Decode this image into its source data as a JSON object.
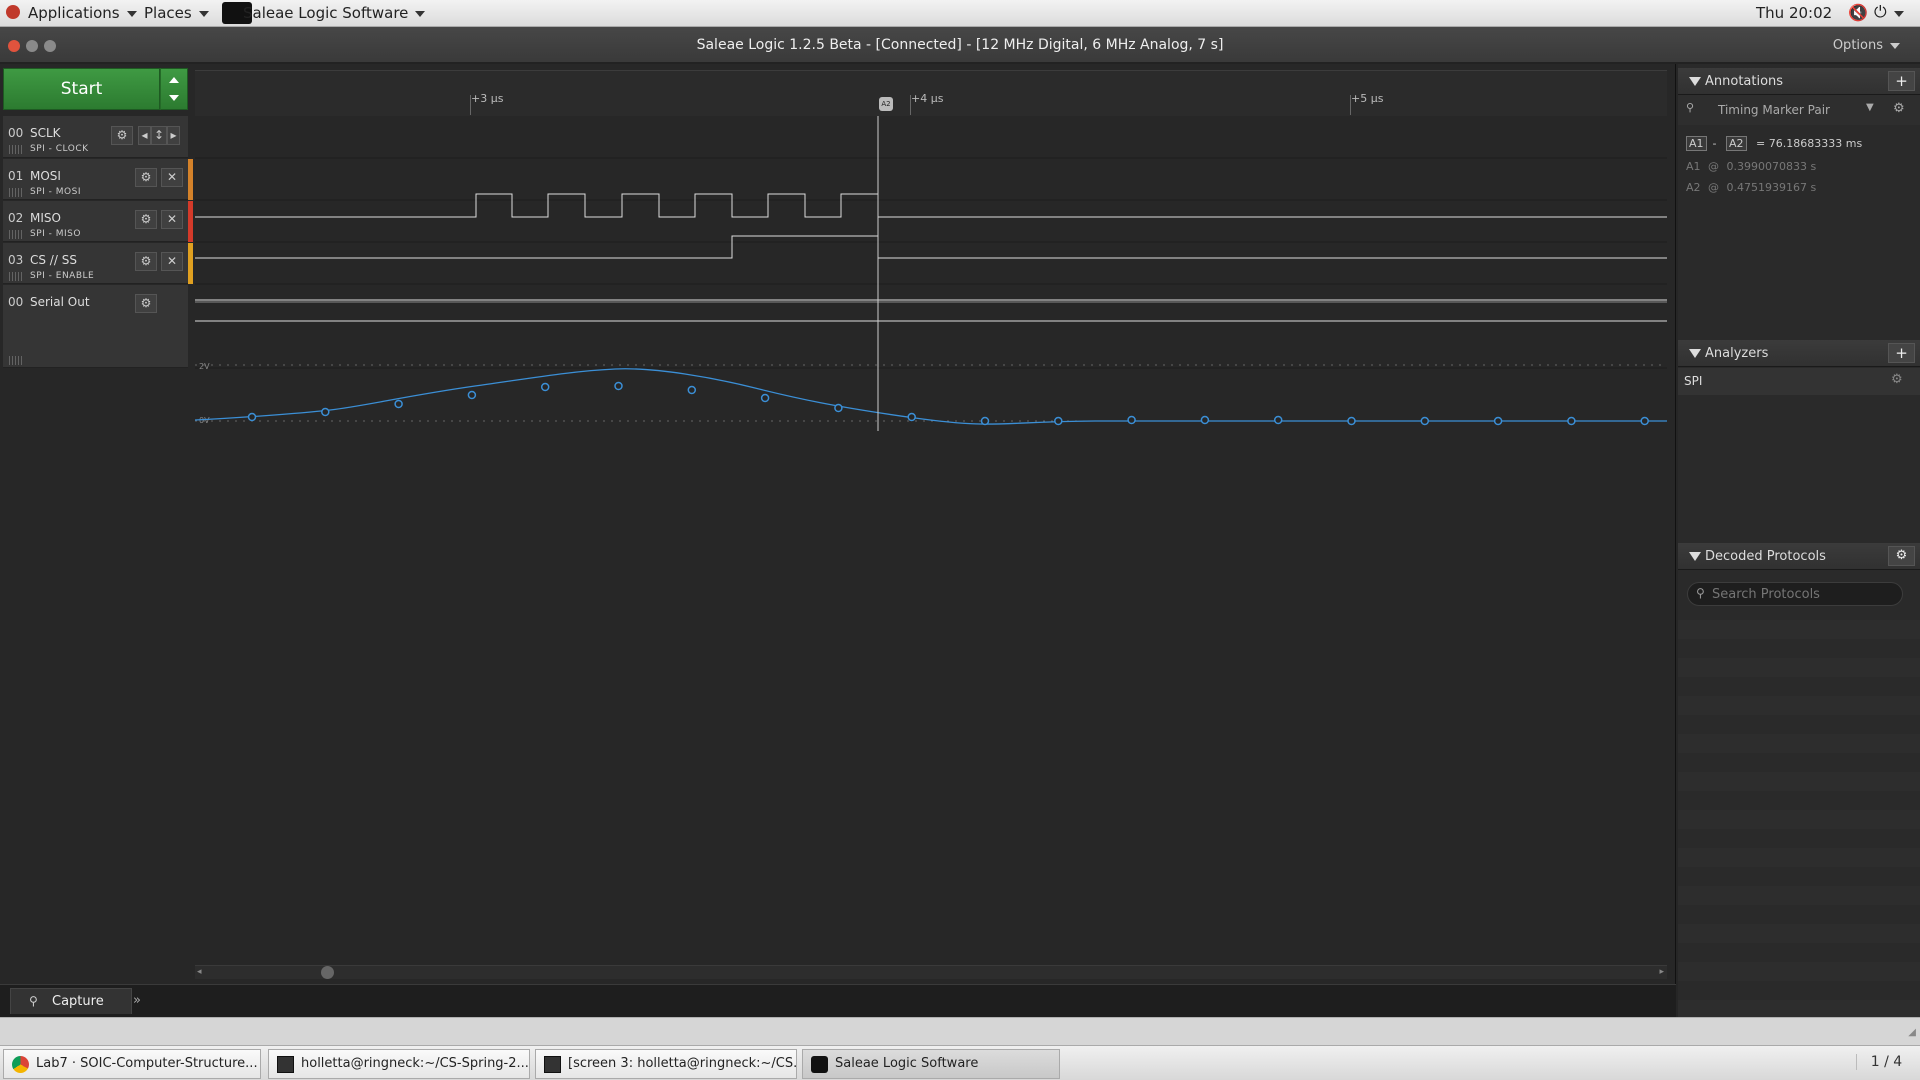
{
  "topbar": {
    "applications": "Applications",
    "places": "Places",
    "active_app": "Saleae Logic Software",
    "clock": "Thu 20:02"
  },
  "window": {
    "title": "Saleae Logic 1.2.5 Beta - [Connected] - [12 MHz Digital, 6 MHz Analog, 7 s]",
    "options": "Options"
  },
  "toolbar": {
    "start_label": "Start"
  },
  "ruler": {
    "labels": [
      "+3 µs",
      "+4 µs",
      "+5 µs"
    ],
    "marker": "A2"
  },
  "channels": [
    {
      "num": "00",
      "name": "SCLK",
      "sub": "SPI - CLOCK"
    },
    {
      "num": "01",
      "name": "MOSI",
      "sub": "SPI - MOSI"
    },
    {
      "num": "02",
      "name": "MISO",
      "sub": "SPI - MISO"
    },
    {
      "num": "03",
      "name": "CS // SS",
      "sub": "SPI - ENABLE"
    },
    {
      "num": "00",
      "name": "Serial Out",
      "sub": ""
    }
  ],
  "analog": {
    "top_label": "2V",
    "bottom_label": "0V"
  },
  "tabs": {
    "capture": "Capture"
  },
  "annotations": {
    "title": "Annotations",
    "marker_pair": "Timing Marker Pair",
    "a1": "A1",
    "a2": "A2",
    "delta_value": "= 76.18683333 ms",
    "a1_row": {
      "label": "A1",
      "at": "@",
      "value": "0.3990070833 s"
    },
    "a2_row": {
      "label": "A2",
      "at": "@",
      "value": "0.4751939167 s"
    }
  },
  "analyzers": {
    "title": "Analyzers",
    "items": [
      "SPI"
    ]
  },
  "decoded": {
    "title": "Decoded Protocols",
    "search_placeholder": "Search Protocols"
  },
  "taskbar": {
    "items": [
      "Lab7 · SOIC-Computer-Structure...",
      "holletta@ringneck:~/CS-Spring-2...",
      "[screen 3: holletta@ringneck:~/CS...",
      "Saleae Logic Software"
    ],
    "workspace": "1 / 4"
  },
  "colors": {
    "accent_green": "#3a8f3e",
    "analog_blue": "#3b8fd6",
    "ch1": "#d4822a",
    "ch2": "#d43a2a",
    "ch3": "#e0a020"
  }
}
